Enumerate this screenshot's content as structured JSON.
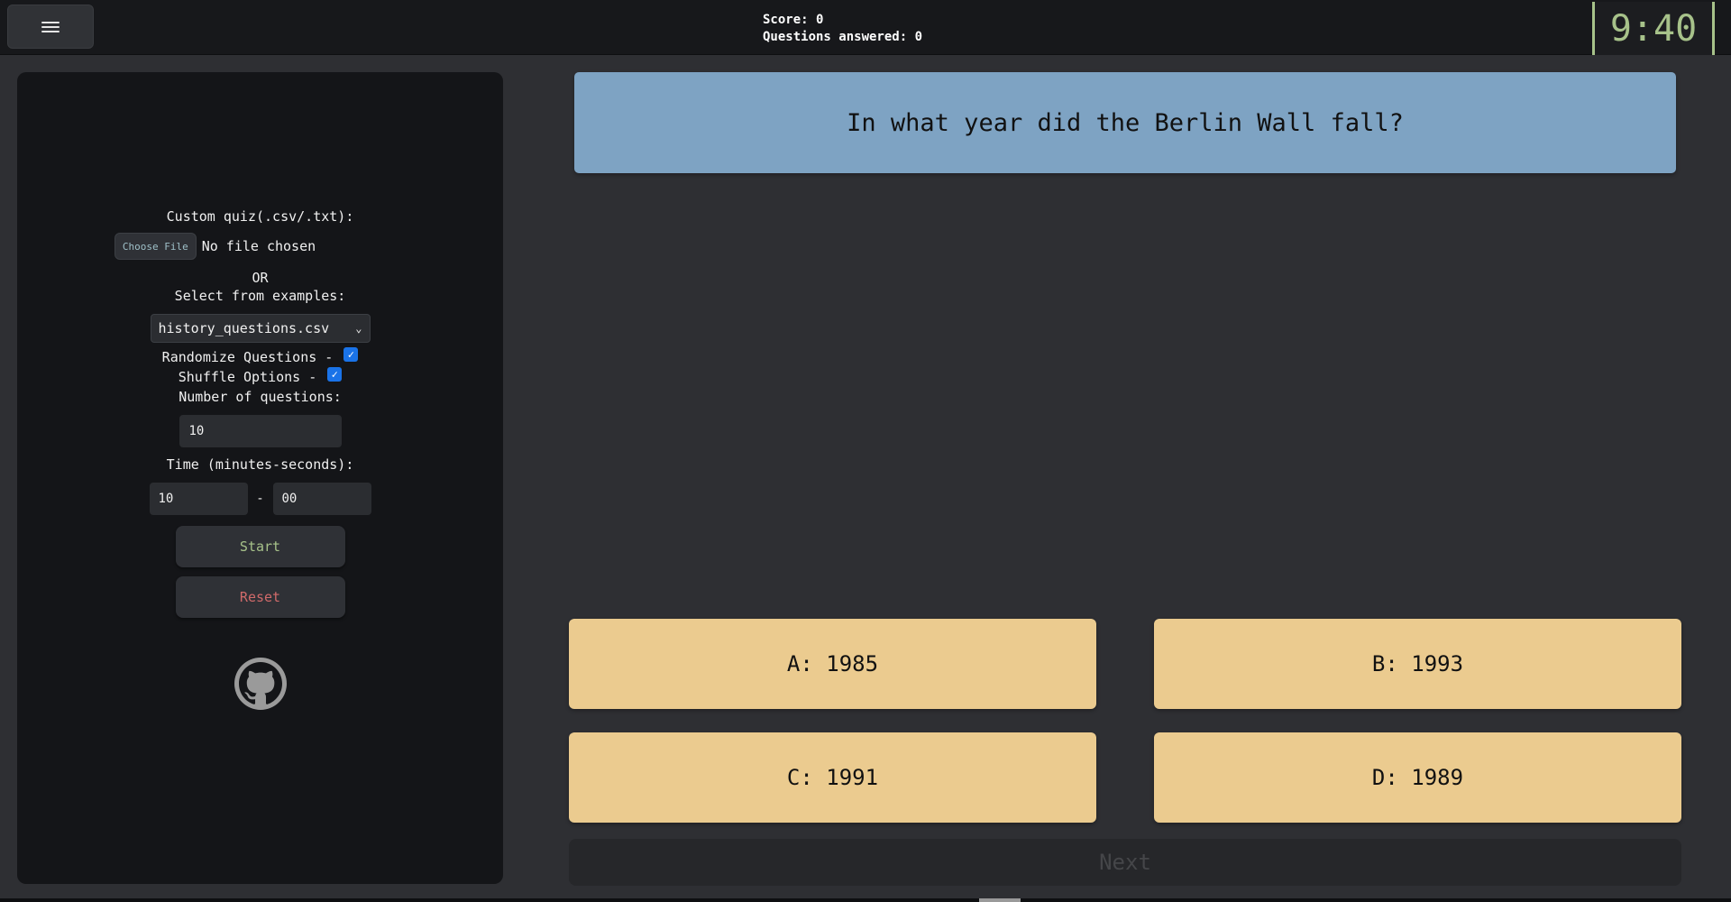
{
  "header": {
    "menu_icon": "hamburger-icon",
    "score_label": "Score: 0",
    "answered_label": "Questions answered: 0",
    "timer": "9:40"
  },
  "sidebar": {
    "custom_quiz_label": "Custom quiz(.csv/.txt):",
    "choose_file_label": "Choose File",
    "file_status": "No file chosen",
    "or_label": "OR",
    "select_examples_label": "Select from examples:",
    "selected_example": "history_questions.csv",
    "randomize_label": "Randomize Questions -",
    "randomize_checked": true,
    "shuffle_label": "Shuffle Options -",
    "shuffle_checked": true,
    "num_questions_label": "Number of questions:",
    "num_questions_value": "10",
    "time_label": "Time (minutes-seconds):",
    "time_minutes": "10",
    "time_separator": "-",
    "time_seconds": "00",
    "start_label": "Start",
    "reset_label": "Reset",
    "github_icon": "github-icon"
  },
  "quiz": {
    "question": "In what year did the Berlin Wall fall?",
    "options": [
      {
        "label": "A: 1985"
      },
      {
        "label": "B: 1993"
      },
      {
        "label": "C: 1991"
      },
      {
        "label": "D: 1989"
      }
    ],
    "next_label": "Next"
  },
  "colors": {
    "background": "#2e2f33",
    "sidebar": "#141518",
    "question_bg": "#7ea3c3",
    "option_bg": "#ebcb8f",
    "timer": "#a7c28a",
    "start_text": "#a7c28a",
    "reset_text": "#d06a6a"
  }
}
